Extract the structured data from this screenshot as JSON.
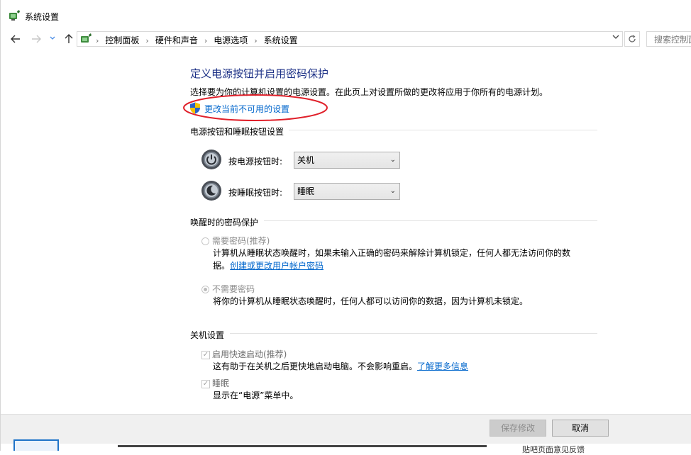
{
  "window": {
    "title": "系统设置",
    "app_icon": "power-options-icon"
  },
  "nav": {
    "back_icon": "arrow-left-icon",
    "forward_icon": "arrow-right-icon",
    "recent_icon": "chevron-down-icon",
    "up_icon": "arrow-up-icon",
    "breadcrumbs": [
      "控制面板",
      "硬件和声音",
      "电源选项",
      "系统设置"
    ],
    "refresh_icon": "refresh-icon",
    "search_placeholder": "搜索控制面板"
  },
  "page": {
    "title": "定义电源按钮并启用密码保护",
    "description": "选择要为你的计算机设置的电源设置。在此页上对设置所做的更改将应用于你所有的电源计划。",
    "change_link": "更改当前不可用的设置"
  },
  "buttons_section": {
    "heading": "电源按钮和睡眠按钮设置",
    "power": {
      "label": "按电源按钮时:",
      "value": "关机"
    },
    "sleep": {
      "label": "按睡眠按钮时:",
      "value": "睡眠"
    }
  },
  "password_section": {
    "heading": "唤醒时的密码保护",
    "require": {
      "label": "需要密码(推荐)",
      "desc_line1": "计算机从睡眠状态唤醒时，如果未输入正确的密码来解除计算机锁定，任何人都无法访问你的数",
      "desc_line2_prefix": "据。",
      "desc_link": "创建或更改用户帐户密码",
      "selected": false
    },
    "no_require": {
      "label": "不需要密码",
      "desc": "将你的计算机从睡眠状态唤醒时，任何人都可以访问你的数据，因为计算机未锁定。",
      "selected": true
    }
  },
  "shutdown_section": {
    "heading": "关机设置",
    "fast_startup": {
      "label": "启用快速启动(推荐)",
      "desc": "这有助于在关机之后更快地启动电脑。不会影响重启。",
      "link": "了解更多信息",
      "checked": true
    },
    "sleep": {
      "label": "睡眠",
      "desc": "显示在“电源”菜单中。",
      "checked": true
    }
  },
  "footer": {
    "save_label": "保存修改",
    "cancel_label": "取消"
  },
  "taskbar_peek": {
    "text": "贴吧页面意见反馈"
  },
  "colors": {
    "title_blue": "#1e3287",
    "link_blue": "#0066cc",
    "annotation_red": "#e0202a"
  }
}
